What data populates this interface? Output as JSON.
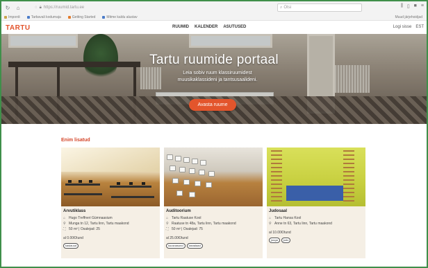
{
  "browser": {
    "url": "https://ruumid.tartu.ee",
    "search_placeholder": "Otsi"
  },
  "bookmarks": [
    {
      "label": "Impordi",
      "color": "#c9a44b"
    },
    {
      "label": "Tarbavali kodumaja",
      "color": "#4b7cc9"
    },
    {
      "label": "Getting Started",
      "color": "#e37b2c"
    },
    {
      "label": "Mitme kaldu alustav",
      "color": "#4b7cc9"
    }
  ],
  "bookmarks_other": "Muud järjehoidjad",
  "site": {
    "logo": "TARTU",
    "nav": [
      "RUUMID",
      "KALENDER",
      "ASUTUSED"
    ],
    "login": "Logi sisse",
    "lang": "EST"
  },
  "hero": {
    "title": "Tartu ruumide portaal",
    "subtitle": "Leia sobiv ruum klassiruumidest muusikaklassideni ja tantsusaalideni.",
    "button": "Avasta ruume"
  },
  "section": {
    "title": "Enim lisatud"
  },
  "cards": [
    {
      "name": "Arvutiklass",
      "institution": "Hugo Treffneri Gümnaasium",
      "address": "Munga tn 12, Tartu linn, Tartu maakond",
      "area": "50 m² | Osalejad: 25",
      "price": "al 0.00€/tund",
      "tags": [
        "kaslauud"
      ]
    },
    {
      "name": "Auditoorium",
      "institution": "Tartu Raatuse Kool",
      "address": "Raatuse tn 48a, Tartu linn, Tartu maakond",
      "area": "50 m² | Osalejad: 75",
      "price": "al 25.00€/tund",
      "tags": [
        "kuusnasund",
        "lasnalaad"
      ]
    },
    {
      "name": "Judosaal",
      "institution": "Tartu Hansa Kool",
      "address": "Anne tn 63, Tartu linn, Tartu maakond",
      "price": "al 10.00€/tund",
      "tags": [
        "juuga",
        "judo"
      ]
    }
  ],
  "colors": {
    "accent": "#e3552c",
    "section_title": "#d4462a",
    "card_bg": "#f5efe5"
  }
}
